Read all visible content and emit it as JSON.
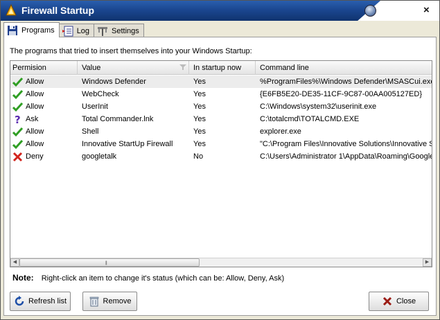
{
  "window": {
    "title": "Firewall Startup"
  },
  "tabs": [
    {
      "label": "Programs",
      "icon": "floppy-disk-icon",
      "active": true
    },
    {
      "label": "Log",
      "icon": "log-list-icon",
      "active": false
    },
    {
      "label": "Settings",
      "icon": "wrench-icon",
      "active": false
    }
  ],
  "intro": "The programs that tried to insert themselves into your Windows Startup:",
  "table": {
    "columns": [
      "Permision",
      "Value",
      "In startup now",
      "Command line"
    ],
    "rows": [
      {
        "permission": "Allow",
        "value": "Windows Defender",
        "in_startup": "Yes",
        "command": "%ProgramFiles%\\Windows Defender\\MSASCui.exe",
        "status": "allow"
      },
      {
        "permission": "Allow",
        "value": "WebCheck",
        "in_startup": "Yes",
        "command": "{E6FB5E20-DE35-11CF-9C87-00AA005127ED}",
        "status": "allow"
      },
      {
        "permission": "Allow",
        "value": "UserInit",
        "in_startup": "Yes",
        "command": "C:\\Windows\\system32\\userinit.exe",
        "status": "allow"
      },
      {
        "permission": "Ask",
        "value": "Total Commander.lnk",
        "in_startup": "Yes",
        "command": "C:\\totalcmd\\TOTALCMD.EXE",
        "status": "ask"
      },
      {
        "permission": "Allow",
        "value": "Shell",
        "in_startup": "Yes",
        "command": "explorer.exe",
        "status": "allow"
      },
      {
        "permission": "Allow",
        "value": "Innovative StartUp Firewall",
        "in_startup": "Yes",
        "command": "\"C:\\Program Files\\Innovative Solutions\\Innovative S",
        "status": "allow"
      },
      {
        "permission": "Deny",
        "value": "googletalk",
        "in_startup": "No",
        "command": "C:\\Users\\Administrator 1\\AppData\\Roaming\\Google",
        "status": "deny"
      }
    ]
  },
  "note": {
    "label": "Note:",
    "text": "Right-click an item to change it's status (which can be: Allow, Deny, Ask)"
  },
  "buttons": {
    "refresh": "Refresh list",
    "remove": "Remove",
    "close": "Close"
  },
  "colors": {
    "allow": "#2f9e23",
    "ask": "#5a2bb0",
    "deny": "#d2231c",
    "title_bar": "#1b4790"
  }
}
